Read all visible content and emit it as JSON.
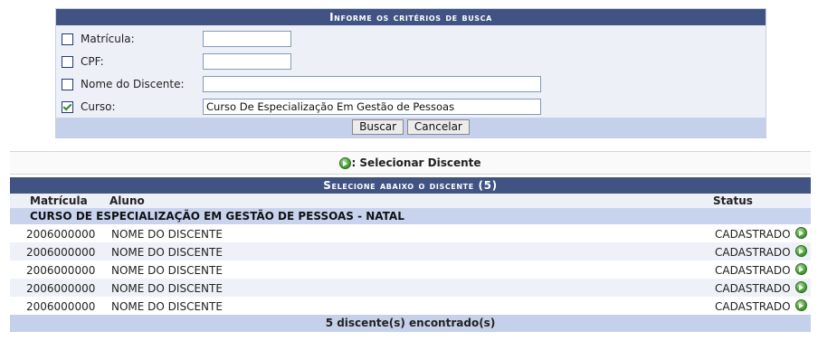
{
  "search_form": {
    "title": "Informe os critérios de busca",
    "fields": [
      {
        "label": "Matrícula:",
        "checked": false,
        "value": ""
      },
      {
        "label": "CPF:",
        "checked": false,
        "value": ""
      },
      {
        "label": "Nome do Discente:",
        "checked": false,
        "value": ""
      },
      {
        "label": "Curso:",
        "checked": true,
        "value": "Curso De Especialização Em Gestão de Pessoas"
      }
    ],
    "search_button": "Buscar",
    "cancel_button": "Cancelar"
  },
  "legend": {
    "icon": "select-arrow-icon",
    "text": ": Selecionar Discente"
  },
  "results": {
    "title": "Selecione abaixo o discente (5)",
    "columns": [
      "Matrícula",
      "Aluno",
      "Status"
    ],
    "group": "CURSO DE ESPECIALIZAÇÃO EM GESTÃO DE PESSOAS - NATAL",
    "rows": [
      {
        "matricula": "2006000000",
        "aluno": "NOME DO DISCENTE",
        "status": "CADASTRADO"
      },
      {
        "matricula": "2006000000",
        "aluno": "NOME DO DISCENTE",
        "status": "CADASTRADO"
      },
      {
        "matricula": "2006000000",
        "aluno": "NOME DO DISCENTE",
        "status": "CADASTRADO"
      },
      {
        "matricula": "2006000000",
        "aluno": "NOME DO DISCENTE",
        "status": "CADASTRADO"
      },
      {
        "matricula": "2006000000",
        "aluno": "NOME DO DISCENTE",
        "status": "CADASTRADO"
      }
    ],
    "footer": "5 discente(s) encontrado(s)"
  },
  "colors": {
    "header_bar": "#415382",
    "form_bg": "#eef0f8",
    "footer_bar": "#c5d0ea",
    "group_row": "#c8d4ee",
    "select_icon": "#4da23a"
  }
}
